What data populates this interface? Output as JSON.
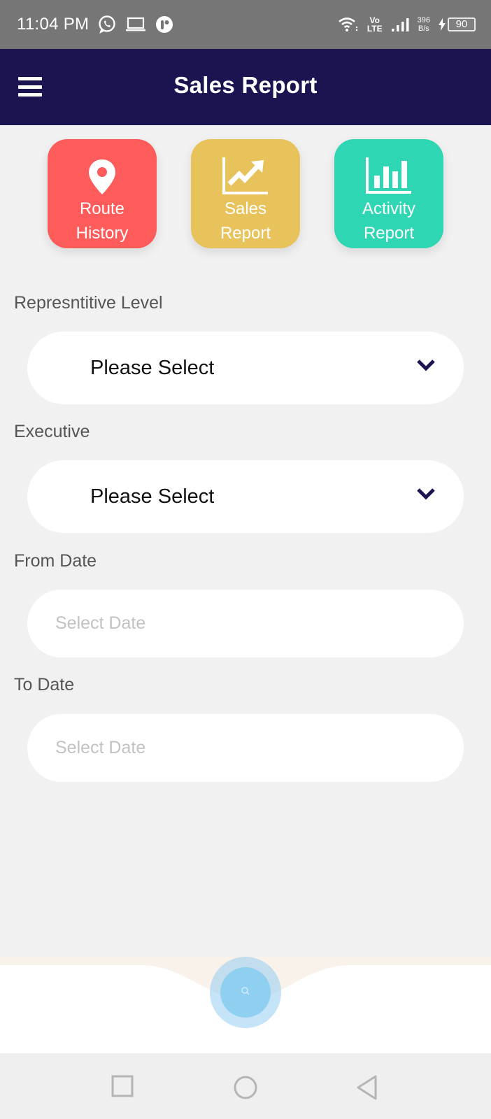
{
  "status_bar": {
    "time": "11:04 PM",
    "left_icons": [
      "whatsapp-icon",
      "laptop-icon",
      "app-notification-icon"
    ],
    "volte_top": "Vo",
    "volte_bottom": "LTE",
    "net_speed_value": "396",
    "net_speed_unit": "B/s",
    "battery_level": "90",
    "charging": true
  },
  "app_bar": {
    "title": "Sales Report",
    "menu_icon": "hamburger-menu-icon"
  },
  "tiles": [
    {
      "line1": "Route",
      "line2": "History",
      "icon": "location-pin-icon",
      "color": "#fe5b5b"
    },
    {
      "line1": "Sales",
      "line2": "Report",
      "icon": "trending-chart-icon",
      "color": "#e8c35c"
    },
    {
      "line1": "Activity",
      "line2": "Report",
      "icon": "bar-chart-icon",
      "color": "#2fd6b3"
    }
  ],
  "form": {
    "representative_level": {
      "label": "Represntitive Level",
      "value": "Please Select"
    },
    "executive": {
      "label": "Executive",
      "value": "Please Select"
    },
    "from_date": {
      "label": "From Date",
      "placeholder": "Select Date",
      "value": ""
    },
    "to_date": {
      "label": "To Date",
      "placeholder": "Select Date",
      "value": ""
    }
  },
  "bottom_nav": {
    "fab_icon": "search-icon"
  },
  "colors": {
    "app_bar": "#1a1550",
    "status_bar": "#767676",
    "background": "#f1f1f1",
    "chevron": "#1a1550"
  }
}
